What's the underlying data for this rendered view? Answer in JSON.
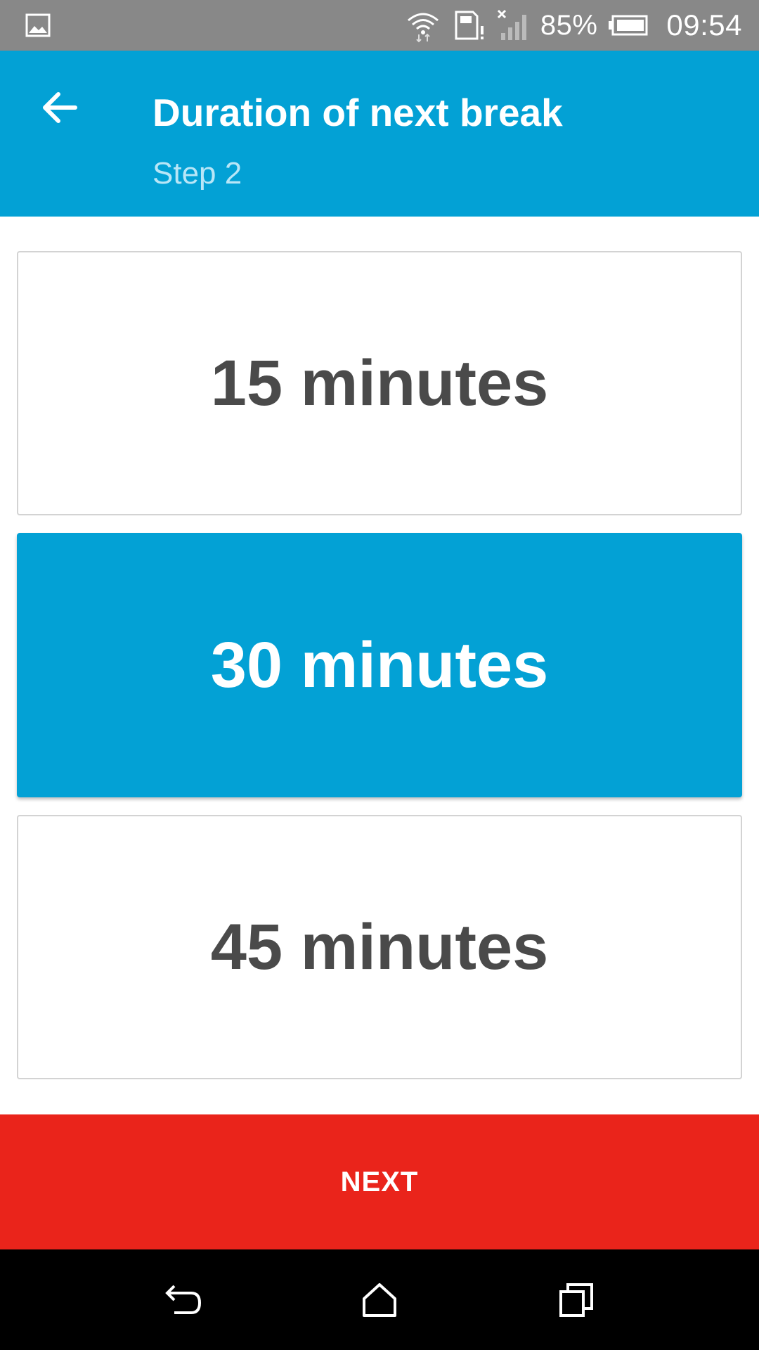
{
  "status_bar": {
    "battery_percent": "85%",
    "time": "09:54",
    "icons": [
      "image-notification-icon",
      "wifi-icon",
      "sim-card-alert-icon",
      "signal-no-service-icon",
      "battery-icon"
    ]
  },
  "app_bar": {
    "back_icon": "arrow-left-icon",
    "title": "Duration of next break",
    "subtitle": "Step 2"
  },
  "options": [
    {
      "label": "15 minutes",
      "selected": false
    },
    {
      "label": "30 minutes",
      "selected": true
    },
    {
      "label": "45 minutes",
      "selected": false
    }
  ],
  "next_button": {
    "label": "NEXT"
  },
  "nav_bar": {
    "icons": [
      "back-icon",
      "home-icon",
      "recents-icon"
    ]
  },
  "colors": {
    "status_bar": "#888888",
    "primary": "#03a1d5",
    "subtitle": "#b8e6f7",
    "accent": "#ea241b",
    "option_text": "#4a4a4a"
  }
}
